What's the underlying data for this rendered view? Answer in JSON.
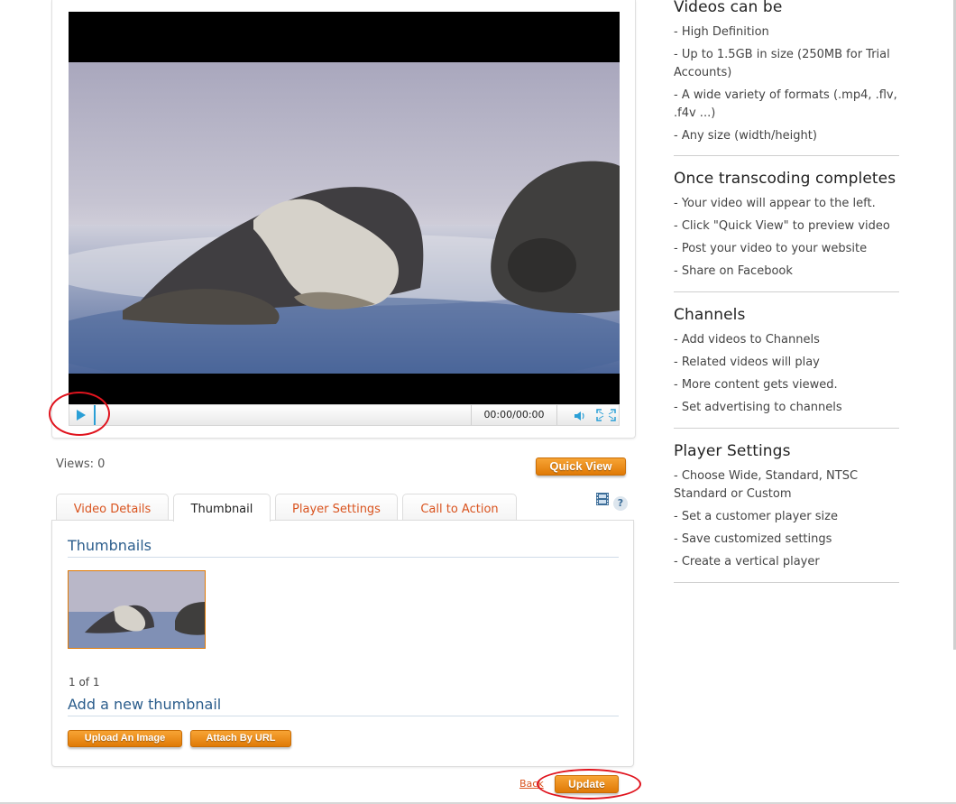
{
  "player": {
    "time_display": "00:00/00:00"
  },
  "stats": {
    "views": "Views: 0"
  },
  "actions": {
    "quick_view": "Quick View",
    "back": "Back",
    "update": "Update"
  },
  "tabs": [
    {
      "label": "Video Details",
      "active": false
    },
    {
      "label": "Thumbnail",
      "active": true
    },
    {
      "label": "Player Settings",
      "active": false
    },
    {
      "label": "Call to Action",
      "active": false
    }
  ],
  "thumbnail_panel": {
    "title": "Thumbnails",
    "page_count": "1 of 1",
    "add_title": "Add a new thumbnail",
    "upload_label": "Upload An Image",
    "attach_label": "Attach By URL"
  },
  "sidebar": {
    "sections": [
      {
        "heading": "Videos can be",
        "items": [
          "- High Definition",
          "- Up to 1.5GB in size (250MB for Trial Accounts)",
          "- A wide variety of formats (.mp4, .flv, .f4v ...)",
          "- Any size (width/height)"
        ]
      },
      {
        "heading": "Once transcoding completes",
        "items": [
          "- Your video will appear to the left.",
          "- Click \"Quick View\" to preview video",
          "- Post your video to your website",
          "- Share on Facebook"
        ]
      },
      {
        "heading": "Channels",
        "items": [
          "- Add videos to Channels",
          "- Related videos will play",
          "- More content gets viewed.",
          "- Set advertising to channels"
        ]
      },
      {
        "heading": "Player Settings",
        "items": [
          "- Choose Wide, Standard, NTSC Standard or Custom",
          "- Set a customer player size",
          "- Save customized settings",
          "- Create a vertical player"
        ]
      }
    ]
  },
  "colors": {
    "accent_orange": "#e88a12",
    "tab_text": "#d9531e",
    "heading_blue": "#2b5d8c",
    "highlight_red": "#e0141e",
    "play_blue": "#2a9fd6"
  }
}
